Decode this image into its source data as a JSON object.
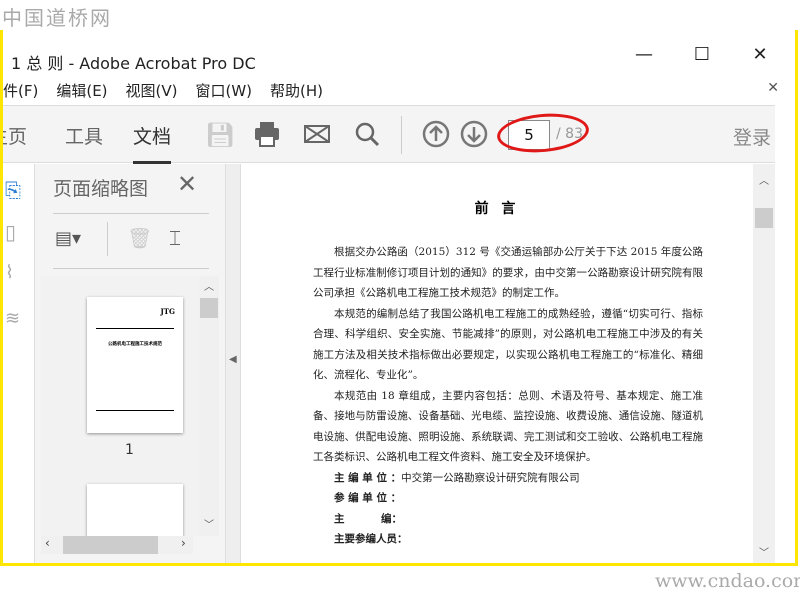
{
  "watermark_top": "中国道桥网",
  "watermark_bottom": "www.cndao.com",
  "window": {
    "title": "1  总   则 - Adobe Acrobat Pro DC",
    "minimize": "—",
    "maximize": "☐",
    "close": "✕"
  },
  "menu": {
    "items": [
      "件(F)",
      "编辑(E)",
      "视图(V)",
      "窗口(W)",
      "帮助(H)"
    ],
    "close": "✕"
  },
  "toolbar": {
    "tabs": [
      "主页",
      "工具",
      "文档"
    ],
    "active_tab": "文档",
    "current_page": "5",
    "total_pages": "/ 83",
    "login": "登录"
  },
  "panel": {
    "title": "页面缩略图",
    "close": "✕",
    "thumbnail_label": "1",
    "thumb_title": "JTG",
    "thumb_heading": "公路机电工程施工技术规范"
  },
  "document": {
    "heading": "前  言",
    "paragraphs": [
      "根据交办公路函（2015）312 号《交通运输部办公厅关于下达 2015 年度公路工程行业标准制修订项目计划的通知》的要求，由中交第一公路勘察设计研究院有限公司承担《公路机电工程施工技术规范》的制定工作。",
      "本规范的编制总结了我国公路机电工程施工的成熟经验，遵循“切实可行、指标合理、科学组织、安全实施、节能减排”的原则，对公路机电工程施工中涉及的有关施工方法及相关技术指标做出必要规定，以实现公路机电工程施工的“标准化、精细化、流程化、专业化”。",
      "本规范由 18 章组成，主要内容包括：总则、术语及符号、基本规定、施工准备、接地与防雷设施、设备基础、光电缆、监控设施、收费设施、通信设施、隧道机电设施、供配电设施、照明设施、系统联调、完工测试和交工验收、公路机电工程施工各类标识、公路机电工程文件资料、施工安全及环境保护。"
    ],
    "credits": [
      {
        "label": "主 编 单 位 ：",
        "value": "中交第一公路勘察设计研究院有限公司"
      },
      {
        "label": "参 编 单 位 ：",
        "value": ""
      },
      {
        "label": "主          编：",
        "value": ""
      },
      {
        "label": "主要参编人员：",
        "value": ""
      }
    ]
  },
  "colors": {
    "frame": "#ffe600",
    "annotation": "#e01818",
    "accent": "#2d7fd3"
  }
}
